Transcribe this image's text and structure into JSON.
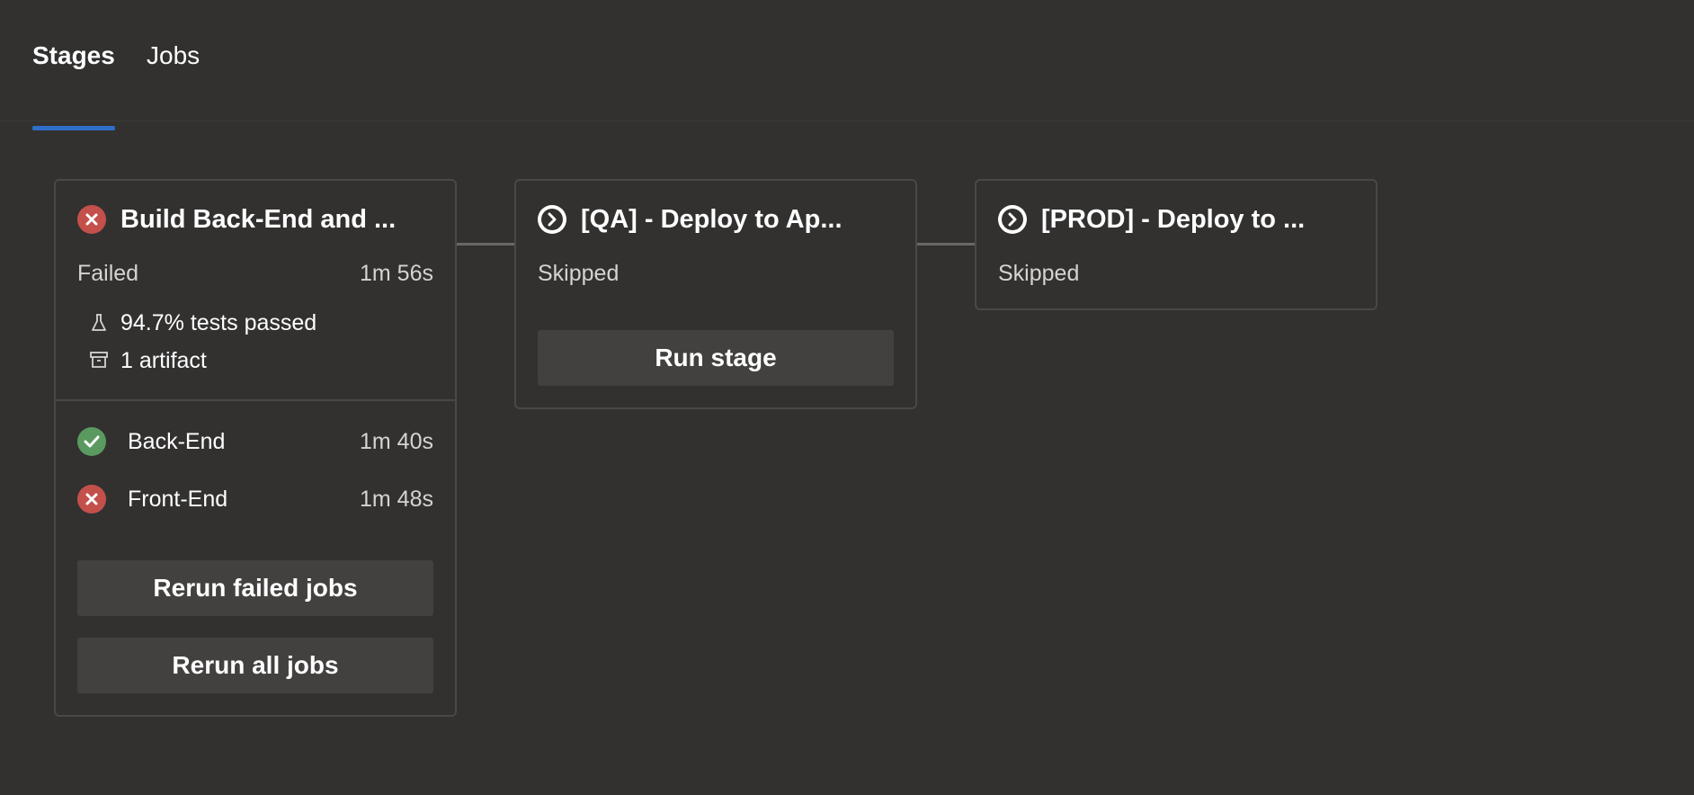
{
  "tabs": [
    {
      "label": "Stages",
      "active": true
    },
    {
      "label": "Jobs",
      "active": false
    }
  ],
  "stages": [
    {
      "title": "Build Back-End and ...",
      "status": "Failed",
      "duration": "1m 56s",
      "status_icon": "error-circle-icon",
      "tests": "94.7% tests passed",
      "artifacts": "1 artifact",
      "jobs": [
        {
          "name": "Back-End",
          "duration": "1m 40s",
          "status": "succeeded",
          "icon": "success-check-icon"
        },
        {
          "name": "Front-End",
          "duration": "1m 48s",
          "status": "failed",
          "icon": "error-circle-icon"
        }
      ],
      "buttons": {
        "rerun_failed": "Rerun failed jobs",
        "rerun_all": "Rerun all jobs"
      }
    },
    {
      "title": "[QA] - Deploy to Ap...",
      "status": "Skipped",
      "status_icon": "skipped-chevron-icon",
      "button": "Run stage"
    },
    {
      "title": "[PROD] - Deploy to ...",
      "status": "Skipped",
      "status_icon": "skipped-chevron-icon"
    }
  ],
  "colors": {
    "background": "#323130",
    "accent": "#2f6fca",
    "failed": "#c4504b",
    "succeeded": "#5a9a60"
  }
}
